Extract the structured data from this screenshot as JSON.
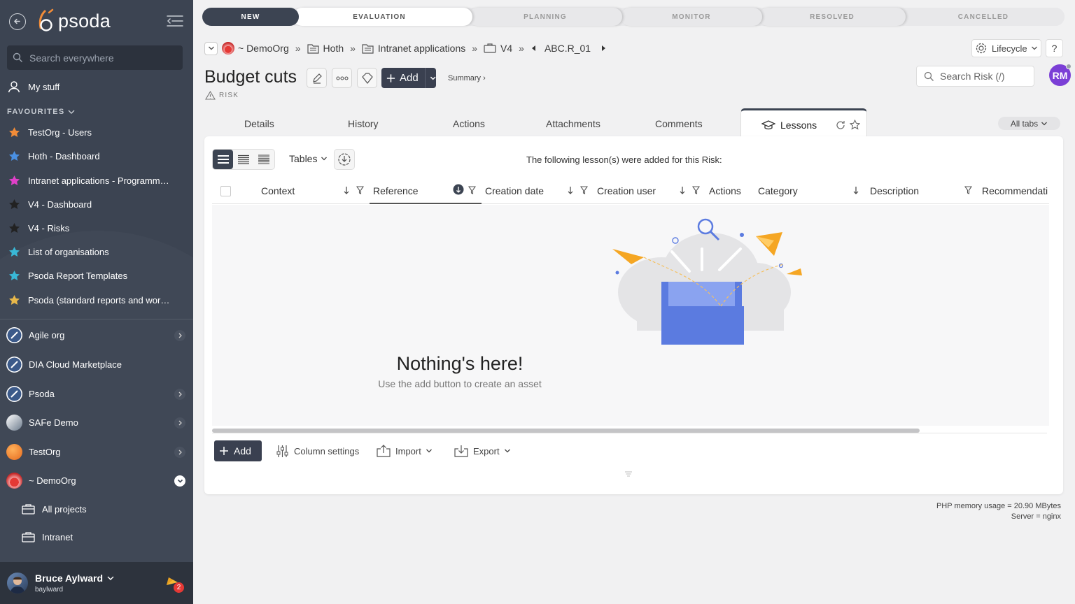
{
  "sidebar": {
    "logo": "psoda",
    "search_placeholder": "Search everywhere",
    "my_stuff": "My stuff",
    "favourites_label": "FAVOURITES",
    "favourites": [
      {
        "label": "TestOrg - Users",
        "color": "#f28c38"
      },
      {
        "label": "Hoth - Dashboard",
        "color": "#4a90e2"
      },
      {
        "label": "Intranet applications - Programme...",
        "color": "#e040c8"
      },
      {
        "label": "V4 - Dashboard",
        "color": "#222222"
      },
      {
        "label": "V4 - Risks",
        "color": "#222222"
      },
      {
        "label": "List of organisations",
        "color": "#39b8d6"
      },
      {
        "label": "Psoda Report Templates",
        "color": "#39b8d6"
      },
      {
        "label": "Psoda (standard reports and work...",
        "color": "#e8b84a"
      }
    ],
    "orgs": [
      {
        "label": "Agile org"
      },
      {
        "label": "DIA Cloud Marketplace"
      },
      {
        "label": "Psoda"
      },
      {
        "label": "SAFe Demo"
      },
      {
        "label": "TestOrg"
      },
      {
        "label": "~ DemoOrg"
      }
    ],
    "sub_items": [
      "All projects",
      "Intranet"
    ],
    "user": {
      "name": "Bruce Aylward",
      "username": "baylward",
      "notifications": "2"
    }
  },
  "lifecycle": [
    "NEW",
    "EVALUATION",
    "PLANNING",
    "MONITOR",
    "RESOLVED",
    "CANCELLED"
  ],
  "breadcrumb": [
    "~ DemoOrg",
    "Hoth",
    "Intranet applications",
    "V4",
    "ABC.R_01"
  ],
  "toolbar": {
    "lifecycle": "Lifecycle",
    "help": "?"
  },
  "page": {
    "title": "Budget cuts",
    "type": "RISK",
    "add_label": "Add",
    "summary": "Summary ›",
    "search_placeholder": "Search Risk (/)",
    "avatar": "RM"
  },
  "tabs": [
    "Details",
    "History",
    "Actions",
    "Attachments",
    "Comments",
    "Lessons"
  ],
  "all_tabs": "All tabs",
  "panel": {
    "tables_label": "Tables",
    "message": "The following lesson(s) were added for this Risk:",
    "columns": [
      "Context",
      "Reference",
      "Creation date",
      "Creation user",
      "Actions",
      "Category",
      "Description",
      "Recommendati"
    ],
    "empty_title": "Nothing's here!",
    "empty_subtitle": "Use the add button to create an asset",
    "add": "Add",
    "column_settings": "Column settings",
    "import": "Import",
    "export": "Export"
  },
  "footer": {
    "memory": "PHP memory usage = 20.90 MBytes",
    "server": "Server = nginx"
  }
}
